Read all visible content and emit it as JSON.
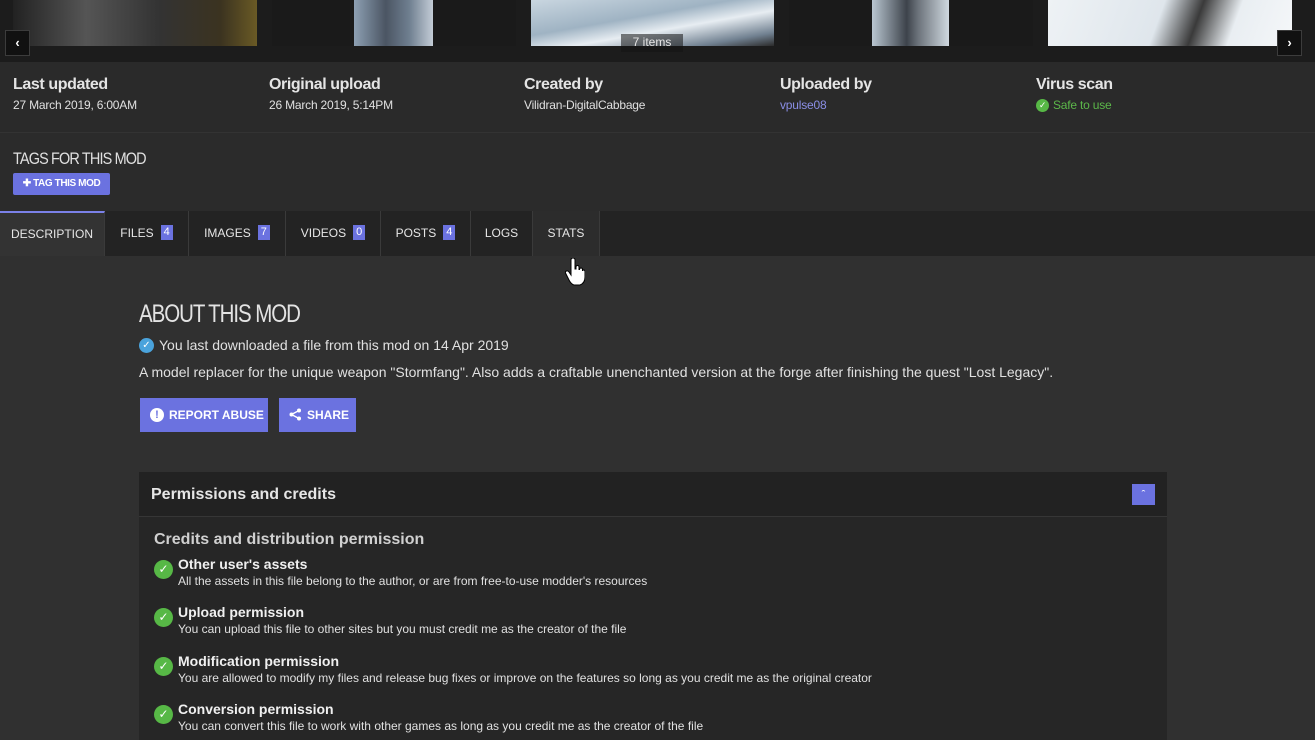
{
  "gallery": {
    "count_label": "7 items",
    "prev_icon": "chevron-left-icon",
    "next_icon": "chevron-right-icon"
  },
  "stats": [
    {
      "label": "Last updated",
      "value": "27 March 2019,  6:00AM",
      "style": "plain"
    },
    {
      "label": "Original upload",
      "value": "26 March 2019,  5:14PM",
      "style": "plain"
    },
    {
      "label": "Created by",
      "value": "Vilidran-DigitalCabbage",
      "style": "plain"
    },
    {
      "label": "Uploaded by",
      "value": "vpulse08",
      "style": "link"
    },
    {
      "label": "Virus scan",
      "value": "Safe to use",
      "style": "safe"
    }
  ],
  "tags": {
    "title": "TAGS FOR THIS MOD",
    "button": "TAG THIS MOD"
  },
  "tabs": [
    {
      "label": "DESCRIPTION",
      "active": true
    },
    {
      "label": "FILES",
      "count": "4"
    },
    {
      "label": "IMAGES",
      "count": "7"
    },
    {
      "label": "VIDEOS",
      "count": "0"
    },
    {
      "label": "POSTS",
      "count": "4"
    },
    {
      "label": "LOGS"
    },
    {
      "label": "STATS"
    }
  ],
  "about": {
    "title": "ABOUT THIS MOD",
    "download_note": "You last downloaded a file from this mod on 14 Apr 2019",
    "description": "A model replacer for the unique weapon \"Stormfang\". Also adds a craftable unenchanted version at the forge after finishing the quest \"Lost Legacy\".",
    "report_label": "REPORT ABUSE",
    "share_label": "SHARE"
  },
  "permissions": {
    "title": "Permissions and credits",
    "subtitle": "Credits and distribution permission",
    "items": [
      {
        "title": "Other user's assets",
        "desc": "All the assets in this file belong to the author, or are from free-to-use modder's resources"
      },
      {
        "title": "Upload permission",
        "desc": "You can upload this file to other sites but you must credit me as the creator of the file"
      },
      {
        "title": "Modification permission",
        "desc": "You are allowed to modify my files and release bug fixes or improve on the features so long as you credit me as the original creator"
      },
      {
        "title": "Conversion permission",
        "desc": "You can convert this file to work with other games as long as you credit me as the creator of the file"
      }
    ]
  },
  "colors": {
    "accent": "#6b72e0",
    "safe": "#57b846",
    "link": "#8a8ee6"
  }
}
